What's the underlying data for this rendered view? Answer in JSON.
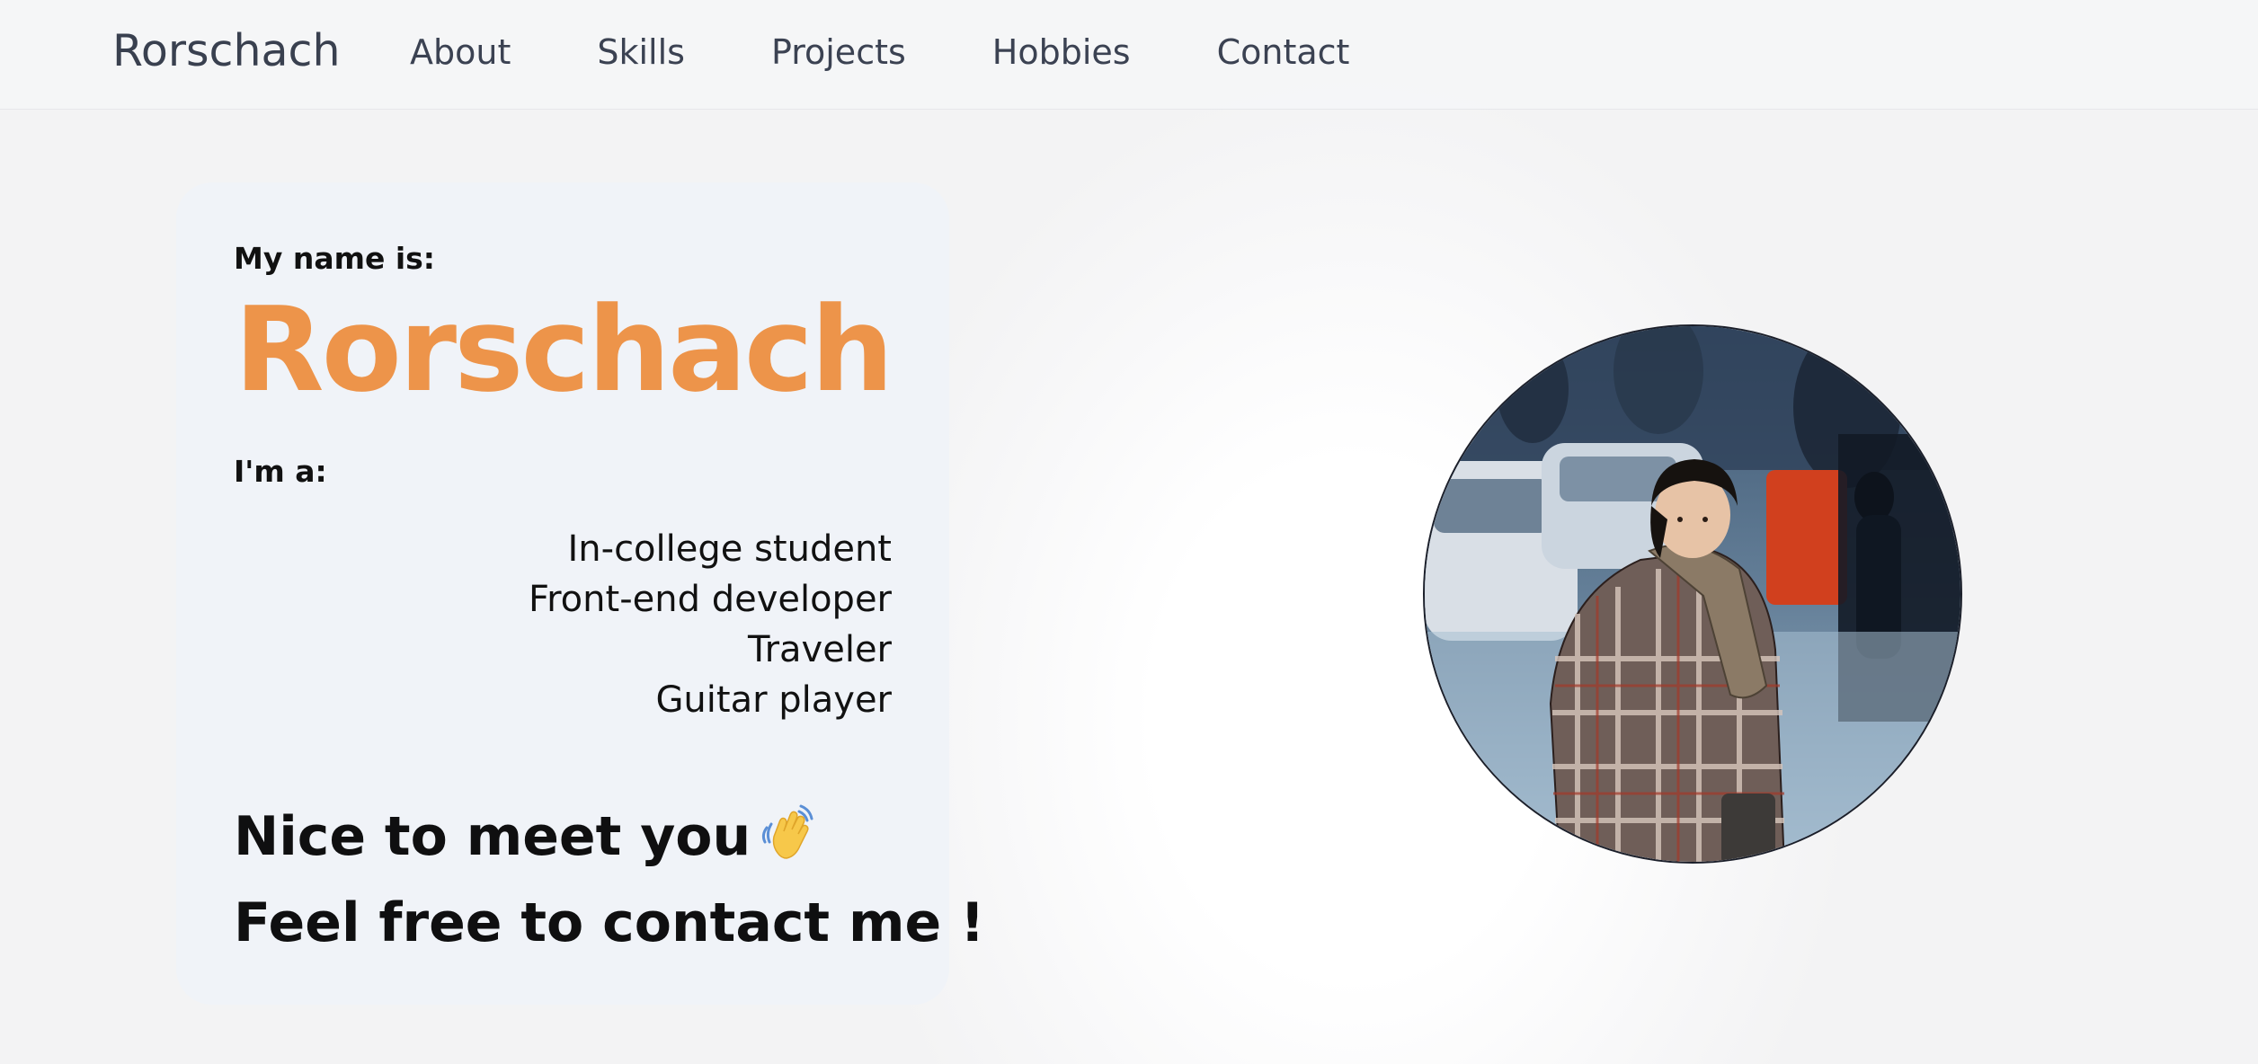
{
  "nav": {
    "brand": "Rorschach",
    "links": [
      "About",
      "Skills",
      "Projects",
      "Hobbies",
      "Contact"
    ]
  },
  "hero": {
    "name_label": "My name is:",
    "name": "Rorschach",
    "role_label": "I'm a:",
    "roles": [
      "In-college student",
      "Front-end developer",
      "Traveler",
      "Guitar player"
    ],
    "greeting": "Nice to meet you",
    "greeting_icon": "waving-hand-icon",
    "cta": "Feel free to contact me !"
  },
  "colors": {
    "accent": "#ed944a",
    "text": "#111111",
    "nav_text": "#3b4252",
    "card_bg": "#f0f3f8"
  }
}
